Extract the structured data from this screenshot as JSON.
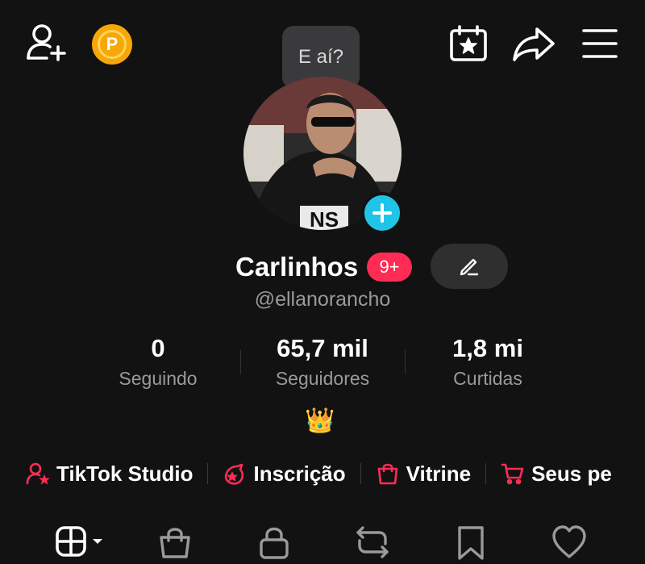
{
  "status_bubble": {
    "text": "E aí?"
  },
  "profile": {
    "name": "Carlinhos",
    "notification_badge": "9+",
    "handle": "@ellanorancho",
    "crown": "👑"
  },
  "stats": [
    {
      "value": "0",
      "label": "Seguindo"
    },
    {
      "value": "65,7 mil",
      "label": "Seguidores"
    },
    {
      "value": "1,8 mi",
      "label": "Curtidas"
    }
  ],
  "points_badge": {
    "letter": "P"
  },
  "quick_links": [
    {
      "label": "TikTok Studio",
      "icon": "person-star-icon"
    },
    {
      "label": "Inscrição",
      "icon": "subscription-icon"
    },
    {
      "label": "Vitrine",
      "icon": "shopping-bag-icon"
    },
    {
      "label": "Seus pe",
      "icon": "cart-icon"
    }
  ],
  "tabs": [
    {
      "icon": "grid-icon"
    },
    {
      "icon": "shop-bag-icon"
    },
    {
      "icon": "lock-icon"
    },
    {
      "icon": "repost-icon"
    },
    {
      "icon": "bookmark-icon"
    },
    {
      "icon": "heart-icon"
    }
  ],
  "colors": {
    "background": "#121212",
    "accent_red": "#fe2c55",
    "cyan_plus": "#20c4e6",
    "points_gold": "#f7a707",
    "muted_text": "#9a9a9a"
  }
}
